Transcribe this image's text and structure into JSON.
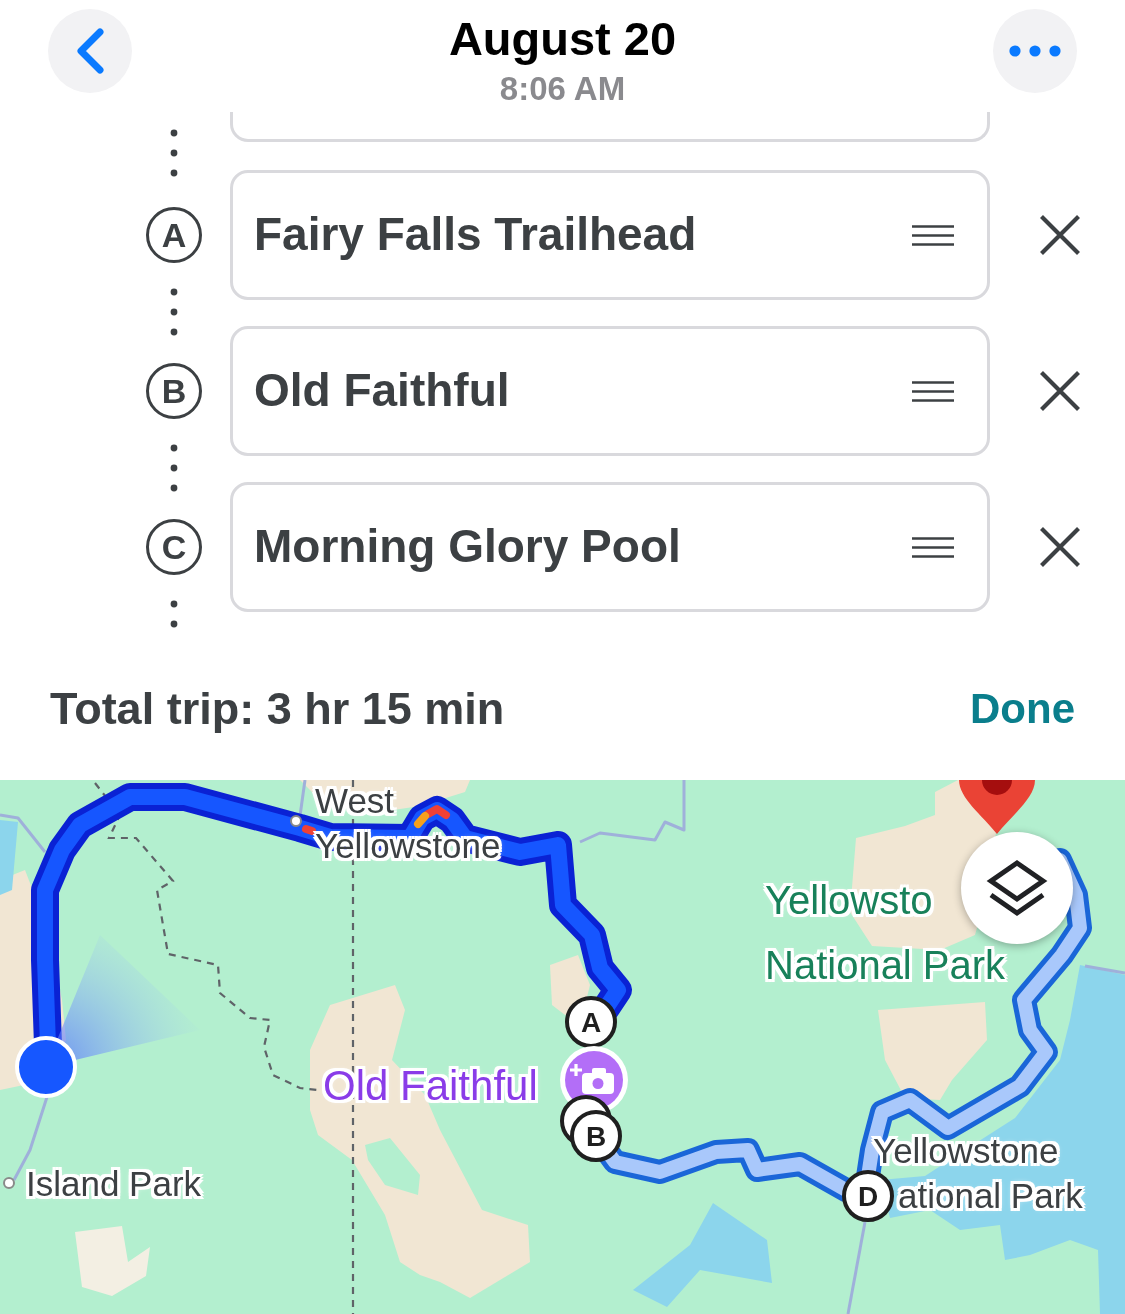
{
  "header": {
    "title": "August 20",
    "subtitle": "8:06 AM"
  },
  "stops": [
    {
      "kind": "hidden"
    },
    {
      "kind": "stop",
      "letter": "A",
      "value": "Fairy Falls Trailhead"
    },
    {
      "kind": "stop",
      "letter": "B",
      "value": "Old Faithful"
    },
    {
      "kind": "stop",
      "letter": "C",
      "value": "Morning Glory Pool"
    }
  ],
  "summary": {
    "total": "Total trip: 3 hr 15 min",
    "action": "Done"
  },
  "map": {
    "labels": [
      {
        "kind": "town",
        "lines": [
          "West",
          "Yellowstone"
        ]
      },
      {
        "kind": "park",
        "lines": [
          "Yellowsto",
          "National Park"
        ]
      },
      {
        "kind": "poi",
        "lines": [
          "Old Faithful"
        ]
      },
      {
        "kind": "town",
        "lines": [
          "Island Park"
        ]
      },
      {
        "kind": "town",
        "lines": [
          "Yellowstone",
          "ational Park"
        ]
      }
    ],
    "markers": [
      {
        "kind": "destination"
      },
      {
        "kind": "stop",
        "letter": "A"
      },
      {
        "kind": "location"
      },
      {
        "kind": "photo"
      },
      {
        "kind": "covered"
      },
      {
        "kind": "stop",
        "letter": "B"
      },
      {
        "kind": "stop",
        "letter": "D"
      }
    ]
  }
}
